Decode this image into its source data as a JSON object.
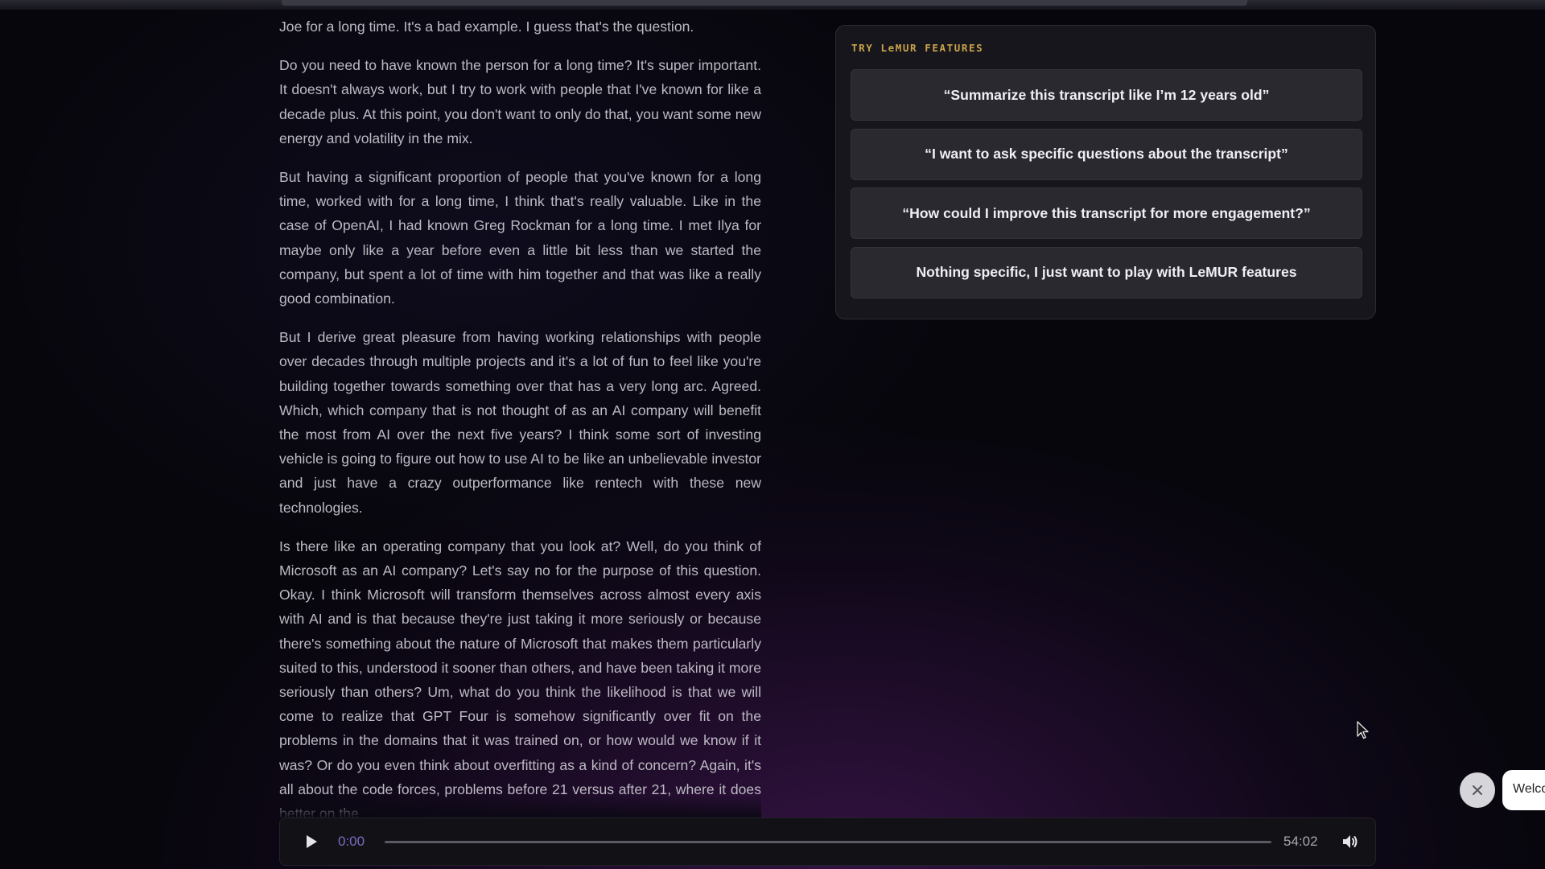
{
  "transcript": {
    "paragraphs": [
      "Joe for a long time. It's a bad example. I guess that's the question.",
      "Do you need to have known the person for a long time? It's super important. It doesn't always work, but I try to work with people that I've known for like a decade plus. At this point, you don't want to only do that, you want some new energy and volatility in the mix.",
      "But having a significant proportion of people that you've known for a long time, worked with for a long time, I think that's really valuable. Like in the case of OpenAI, I had known Greg Rockman for a long time. I met Ilya for maybe only like a year before even a little bit less than we started the company, but spent a lot of time with him together and that was like a really good combination.",
      "But I derive great pleasure from having working relationships with people over decades through multiple projects and it's a lot of fun to feel like you're building together towards something over that has a very long arc. Agreed. Which, which company that is not thought of as an AI company will benefit the most from AI over the next five years? I think some sort of investing vehicle is going to figure out how to use AI to be like an unbelievable investor and just have a crazy outperformance like rentech with these new technologies.",
      "Is there like an operating company that you look at? Well, do you think of Microsoft as an AI company? Let's say no for the purpose of this question. Okay. I think Microsoft will transform themselves across almost every axis with AI and is that because they're just taking it more seriously or because there's something about the nature of Microsoft that makes them particularly suited to this, understood it sooner than others, and have been taking it more seriously than others? Um, what do you think the likelihood is that we will come to realize that GPT Four is somehow significantly over fit on the problems in the domains that it was trained on, or how would we know if it was? Or do you even think about overfitting as a kind of concern? Again, it's all about the code forces, problems before 21 versus after 21, where it does better on the"
    ]
  },
  "lemur": {
    "title": "TRY LeMUR FEATURES",
    "options": [
      "“Summarize this transcript like I’m 12 years old”",
      "“I want to ask specific questions about the transcript”",
      "“How could I improve this transcript for more engagement?”",
      "Nothing specific, I just want to play with LeMUR features"
    ],
    "accent_color": "#c9a44c"
  },
  "player": {
    "current_time": "0:00",
    "total_time": "54:02",
    "progress": 0,
    "play_icon": "play-icon",
    "volume_icon": "volume-icon"
  },
  "chat": {
    "greeting": "Welcome",
    "close_icon": "close-icon"
  }
}
